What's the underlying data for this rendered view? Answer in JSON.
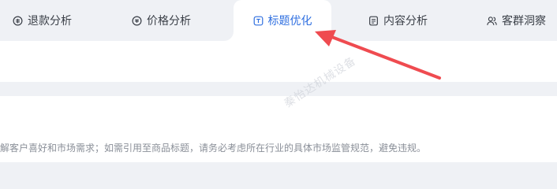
{
  "tabs": [
    {
      "label": "退款分析",
      "icon": "refund-icon",
      "active": false
    },
    {
      "label": "价格分析",
      "icon": "price-icon",
      "active": false
    },
    {
      "label": "标题优化",
      "icon": "title-icon",
      "active": true
    },
    {
      "label": "内容分析",
      "icon": "content-icon",
      "active": false
    },
    {
      "label": "客群洞察",
      "icon": "audience-icon",
      "active": false
    }
  ],
  "notice": "解客户喜好和市场需求；如需引用至商品标题，请务必考虑所在行业的具体市场监管规范，避免违规。",
  "watermark": "秦怡达机械设备",
  "colors": {
    "accent": "#2f6fe0",
    "annotation_arrow": "#ef4b50",
    "page_bg": "#eff1f5",
    "panel_bg": "#ffffff"
  }
}
